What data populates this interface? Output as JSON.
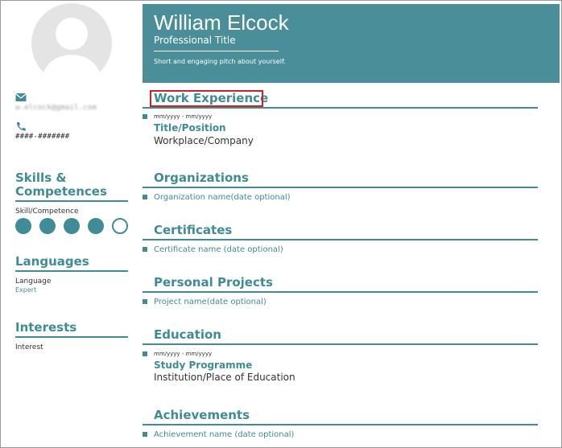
{
  "profile": {
    "name": "William Elcock",
    "title": "Professional Title",
    "pitch": "Short and engaging pitch about yourself."
  },
  "contact": {
    "email": "w.elcock@gmail.com",
    "phone": "####-#######"
  },
  "sidebar": {
    "skills_heading_line1": "Skills &",
    "skills_heading_line2": "Competences",
    "skill_label": "Skill/Competence",
    "skill_level": 4,
    "skill_max": 5,
    "languages_heading": "Languages",
    "language_label": "Language",
    "language_level": "Expert",
    "interests_heading": "Interests",
    "interest_label": "Interest"
  },
  "sections": {
    "work": {
      "heading": "Work Experience",
      "date": "mm/yyyy - mm/yyyy",
      "title": "Title/Position",
      "subtitle": "Workplace/Company"
    },
    "organizations": {
      "heading": "Organizations",
      "item": "Organization name(date optional)"
    },
    "certificates": {
      "heading": "Certificates",
      "item": "Certificate name (date optional)"
    },
    "projects": {
      "heading": "Personal Projects",
      "item": "Project name(date optional)"
    },
    "education": {
      "heading": "Education",
      "date": "mm/yyyy - mm/yyyy",
      "title": "Study Programme",
      "subtitle": "Institution/Place of Education"
    },
    "achievements": {
      "heading": "Achievements",
      "item": "Achievement name (date optional)"
    }
  },
  "colors": {
    "accent": "#3f8b96",
    "banner": "#4a8e99",
    "highlight": "#d21f2a"
  }
}
